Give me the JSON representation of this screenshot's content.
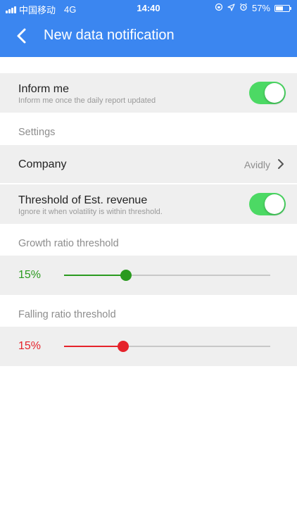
{
  "status_bar": {
    "carrier": "中国移动",
    "network": "4G",
    "time": "14:40",
    "battery": "57%",
    "battery_level": 0.57
  },
  "nav": {
    "title": "New data notification",
    "back_icon": "chevron-left-icon"
  },
  "inform": {
    "title": "Inform me",
    "subtitle": "Inform me once the daily report updated",
    "enabled": true
  },
  "settings_label": "Settings",
  "company": {
    "title": "Company",
    "value": "Avidly"
  },
  "threshold": {
    "title": "Threshold of Est. revenue",
    "subtitle": "Ignore it when volatility is within threshold.",
    "enabled": true
  },
  "growth": {
    "label": "Growth ratio threshold",
    "value_text": "15%",
    "level": 0.3,
    "color": "#2a9a1f"
  },
  "falling": {
    "label": "Falling ratio threshold",
    "value_text": "15%",
    "level": 0.285,
    "color": "#e5232b"
  },
  "colors": {
    "accent": "#3b86f0",
    "toggle_on": "#4cd964"
  }
}
